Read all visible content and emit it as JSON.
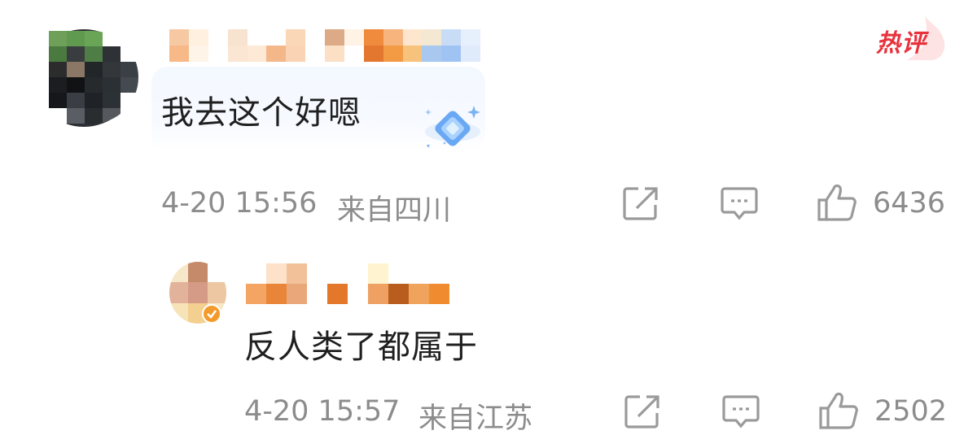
{
  "header": {
    "hot_badge": "热评"
  },
  "comments": [
    {
      "text": "我去这个好嗯",
      "time": "4-20 15:56",
      "location": "来自四川",
      "likes": "6436"
    },
    {
      "text": "反人类了都属于",
      "time": "4-20 15:57",
      "location": "来自江苏",
      "likes": "2502"
    }
  ],
  "icons": {
    "forward": "share-icon",
    "comment": "comment-icon",
    "like": "thumbs-up-icon",
    "sticker": "diamond-sticker-icon",
    "verified": "verified-badge-icon"
  },
  "colors": {
    "meta_gray": "#8c8c8c",
    "hot_red": "#e8323c",
    "verified_orange": "#f39a2b",
    "sticker_blue": "#5b9cf0"
  }
}
